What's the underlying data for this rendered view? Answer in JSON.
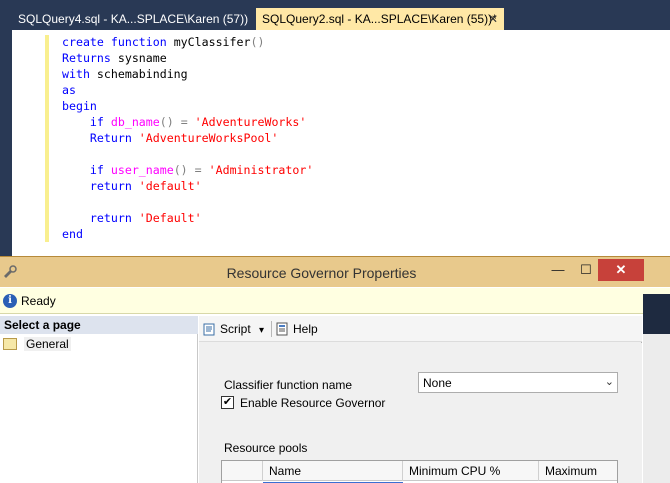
{
  "tabs": {
    "inactive": {
      "label": "SQLQuery4.sql - KA...SPLACE\\Karen (57))"
    },
    "active": {
      "label": "SQLQuery2.sql - KA...SPLACE\\Karen (55))*",
      "close": "✕"
    }
  },
  "editor": {
    "lines": [
      [
        {
          "t": "create",
          "c": "kw"
        },
        {
          "t": " ",
          "c": "blk"
        },
        {
          "t": "function",
          "c": "kw"
        },
        {
          "t": " myClassifer",
          "c": "blk"
        },
        {
          "t": "()",
          "c": "gy"
        }
      ],
      [
        {
          "t": "Returns",
          "c": "kw"
        },
        {
          "t": " sysname",
          "c": "blk"
        }
      ],
      [
        {
          "t": "with",
          "c": "kw"
        },
        {
          "t": " schemabinding",
          "c": "blk"
        }
      ],
      [
        {
          "t": "as",
          "c": "kw"
        }
      ],
      [
        {
          "t": "begin",
          "c": "kw"
        }
      ],
      [
        {
          "t": "    ",
          "c": "blk"
        },
        {
          "t": "if",
          "c": "kw"
        },
        {
          "t": " ",
          "c": "blk"
        },
        {
          "t": "db_name",
          "c": "fn"
        },
        {
          "t": "()",
          "c": "gy"
        },
        {
          "t": " ",
          "c": "blk"
        },
        {
          "t": "=",
          "c": "gy"
        },
        {
          "t": " ",
          "c": "blk"
        },
        {
          "t": "'AdventureWorks'",
          "c": "str"
        }
      ],
      [
        {
          "t": "    ",
          "c": "blk"
        },
        {
          "t": "Return",
          "c": "kw"
        },
        {
          "t": " ",
          "c": "blk"
        },
        {
          "t": "'AdventureWorksPool'",
          "c": "str"
        }
      ],
      [],
      [
        {
          "t": "    ",
          "c": "blk"
        },
        {
          "t": "if",
          "c": "kw"
        },
        {
          "t": " ",
          "c": "blk"
        },
        {
          "t": "user_name",
          "c": "fn"
        },
        {
          "t": "()",
          "c": "gy"
        },
        {
          "t": " ",
          "c": "blk"
        },
        {
          "t": "=",
          "c": "gy"
        },
        {
          "t": " ",
          "c": "blk"
        },
        {
          "t": "'Administrator'",
          "c": "str"
        }
      ],
      [
        {
          "t": "    ",
          "c": "blk"
        },
        {
          "t": "return",
          "c": "kw"
        },
        {
          "t": " ",
          "c": "blk"
        },
        {
          "t": "'default'",
          "c": "str"
        }
      ],
      [],
      [
        {
          "t": "    ",
          "c": "blk"
        },
        {
          "t": "return",
          "c": "kw"
        },
        {
          "t": " ",
          "c": "blk"
        },
        {
          "t": "'Default'",
          "c": "str"
        }
      ],
      [
        {
          "t": "end",
          "c": "kw"
        }
      ]
    ]
  },
  "dialog": {
    "title": "Resource Governor Properties",
    "window_buttons": {
      "minimize": "—",
      "maximize": "☐",
      "close": "✕"
    },
    "status": {
      "icon": "i",
      "text": "Ready"
    },
    "pages": {
      "header": "Select a page",
      "items": [
        {
          "label": "General"
        }
      ]
    },
    "toolbar": {
      "script_label": "Script",
      "script_arrow": "▾",
      "help_label": "Help"
    },
    "form": {
      "classifier_label": "Classifier function name",
      "classifier_value": "None",
      "dropdown_arrow": "⌄",
      "enable_label": "Enable Resource Governor",
      "enable_checked": "✔",
      "pools_label": "Resource pools"
    },
    "grid": {
      "columns": [
        "",
        "Name",
        "Minimum CPU %",
        "Maximum"
      ]
    }
  },
  "colors": {
    "chrome": "#293955",
    "active_tab": "#ffe8a6",
    "dialog_title": "#e8c98c",
    "close_button": "#c7413a"
  }
}
